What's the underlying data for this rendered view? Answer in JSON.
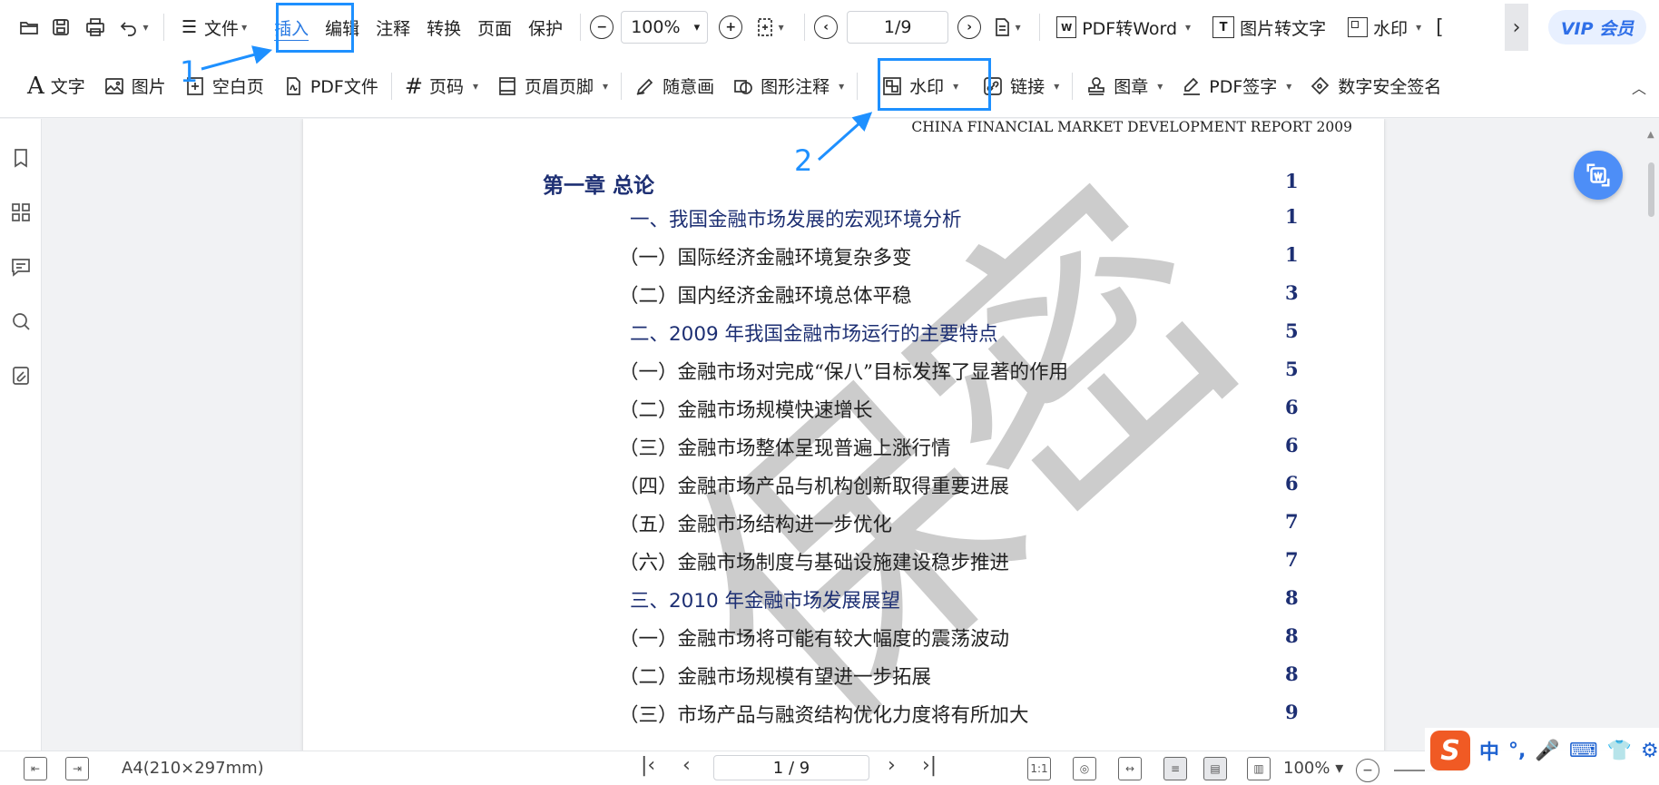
{
  "menubar": {
    "menus": [
      "文件",
      "插入",
      "编辑",
      "注释",
      "转换",
      "页面",
      "保护"
    ],
    "active_menu": "插入",
    "zoom": "100%",
    "page_indicator": "1/9",
    "pdf_to_word": "PDF转Word",
    "img_to_text": "图片转文字",
    "watermark": "水印",
    "vip": "VIP 会员"
  },
  "ribbon": {
    "text": "文字",
    "image": "图片",
    "blank_page": "空白页",
    "pdf_file": "PDF文件",
    "page_number": "页码",
    "header_footer": "页眉页脚",
    "freehand": "随意画",
    "shape_annotation": "图形注释",
    "watermark": "水印",
    "link": "链接",
    "stamp": "图章",
    "pdf_sign": "PDF签字",
    "digital_sign": "数字安全签名"
  },
  "annotations": {
    "step1": "1",
    "step2": "2"
  },
  "document": {
    "running_header": "CHINA FINANCIAL MARKET DEVELOPMENT REPORT 2009",
    "watermark_text": "保密",
    "toc": [
      {
        "text": "第一章   总论",
        "page": "1"
      },
      {
        "text": "一、我国金融市场发展的宏观环境分析",
        "page": "1"
      },
      {
        "text": "（一）国际经济金融环境复杂多变",
        "page": "1"
      },
      {
        "text": "（二）国内经济金融环境总体平稳",
        "page": "3"
      },
      {
        "text": "二、2009 年我国金融市场运行的主要特点",
        "page": "5"
      },
      {
        "text": "（一）金融市场对完成“保八”目标发挥了显著的作用",
        "page": "5"
      },
      {
        "text": "（二）金融市场规模快速增长",
        "page": "6"
      },
      {
        "text": "（三）金融市场整体呈现普遍上涨行情",
        "page": "6"
      },
      {
        "text": "（四）金融市场产品与机构创新取得重要进展",
        "page": "6"
      },
      {
        "text": "（五）金融市场结构进一步优化",
        "page": "7"
      },
      {
        "text": "（六）金融市场制度与基础设施建设稳步推进",
        "page": "7"
      },
      {
        "text": "三、2010 年金融市场发展展望",
        "page": "8"
      },
      {
        "text": "（一）金融市场将可能有较大幅度的震荡波动",
        "page": "8"
      },
      {
        "text": "（二）金融市场规模有望进一步拓展",
        "page": "8"
      },
      {
        "text": "（三）市场产品与融资结构优化力度将有所加大",
        "page": "9"
      }
    ]
  },
  "status": {
    "paper_size": "A4(210×297mm)",
    "page": "1 / 9",
    "zoom": "100%"
  },
  "ime": {
    "lang": "中",
    "punct": "°,"
  },
  "colors": {
    "accent": "#2a7ae2",
    "annotation": "#1e90ff",
    "toc_blue": "#1d2f73",
    "vip_bg": "#e8f0ff"
  }
}
